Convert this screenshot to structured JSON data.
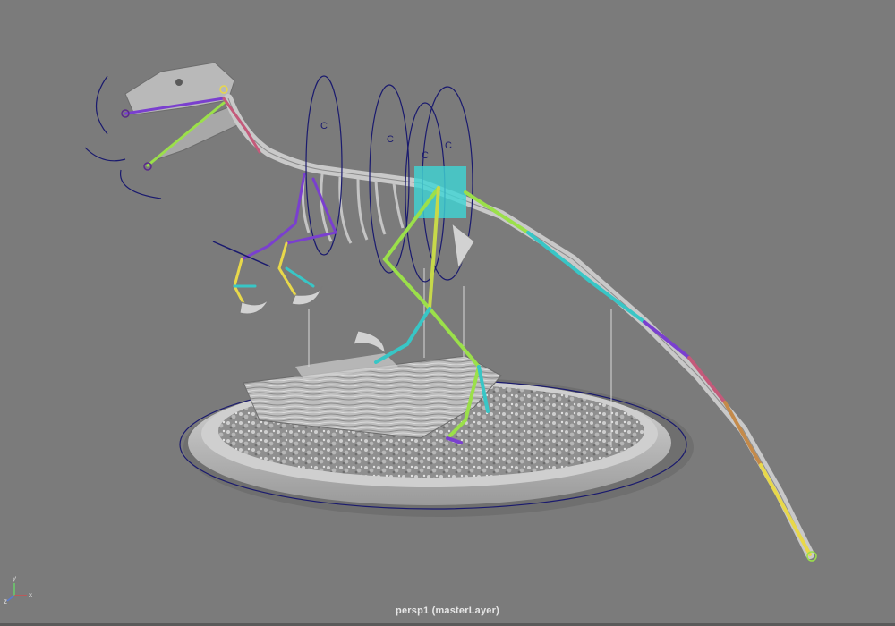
{
  "viewport": {
    "camera_label": "persp1 (masterLayer)",
    "axis": {
      "x": "x",
      "y": "y",
      "z": "z"
    }
  },
  "controls": {
    "center_marker": "C"
  },
  "colors": {
    "background": "#7b7b7b",
    "control_curve": "#1a1a6e",
    "selection_box": "#3fd6d6",
    "joint_green": "#9be04a",
    "joint_yellow": "#e8d84a",
    "joint_purple": "#7a3fcf",
    "joint_cyan": "#38c6c6"
  },
  "icons": [
    "axis-gizmo-icon"
  ]
}
